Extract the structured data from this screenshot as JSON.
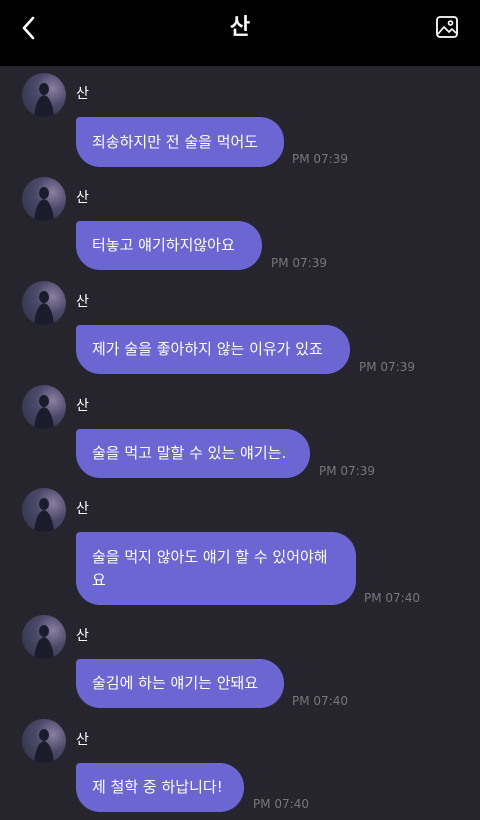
{
  "header": {
    "title": "산",
    "back_icon": "chevron-left-icon",
    "gallery_icon": "image-icon"
  },
  "messages": [
    {
      "sender": "산",
      "text": "죄송하지만 전 술을 먹어도",
      "time": "PM 07:39"
    },
    {
      "sender": "산",
      "text": "터놓고 얘기하지않아요",
      "time": "PM 07:39"
    },
    {
      "sender": "산",
      "text": "제가 술을 좋아하지 않는 이유가 있죠",
      "time": "PM 07:39"
    },
    {
      "sender": "산",
      "text": "술을 먹고 말할 수 있는 얘기는.",
      "time": "PM 07:39"
    },
    {
      "sender": "산",
      "text": "술을 먹지 않아도 얘기 할 수 있어야해\n요",
      "time": "PM 07:40"
    },
    {
      "sender": "산",
      "text": "술김에 하는 얘기는 안돼요",
      "time": "PM 07:40"
    },
    {
      "sender": "산",
      "text": "제 철학 중 하납니다!",
      "time": "PM 07:40"
    }
  ]
}
